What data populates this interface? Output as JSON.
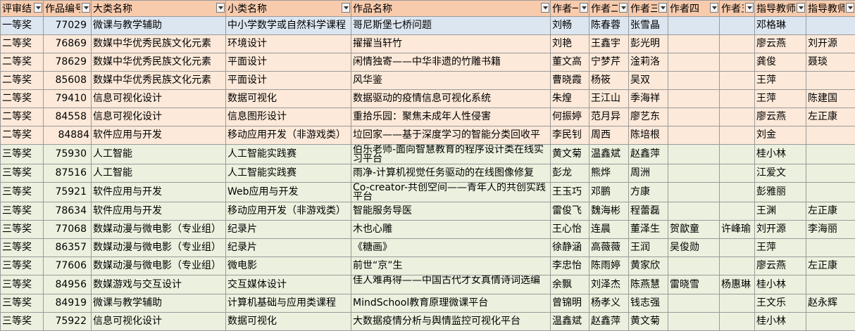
{
  "columns": [
    {
      "label": "评审结果",
      "width": 61
    },
    {
      "label": "作品编号",
      "width": 68
    },
    {
      "label": "大类名称",
      "width": 191
    },
    {
      "label": "小类名称",
      "width": 178
    },
    {
      "label": "作品名称",
      "width": 283
    },
    {
      "label": "作者一",
      "width": 55
    },
    {
      "label": "作者二",
      "width": 56
    },
    {
      "label": "作者三",
      "width": 56
    },
    {
      "label": "作者四",
      "width": 73
    },
    {
      "label": "作者五",
      "width": 50
    },
    {
      "label": "指导教师一",
      "width": 73
    },
    {
      "label": "指导教师二",
      "width": 70
    }
  ],
  "rows": [
    {
      "style": "r-blue",
      "cells": [
        "一等奖",
        "77029",
        "微课与教学辅助",
        "中小学数学或自然科学课程",
        "哥尼斯堡七桥问题",
        "刘畅",
        "陈春蓉",
        "张雪晶",
        "",
        "",
        "邓格琳",
        ""
      ]
    },
    {
      "style": "r-peach",
      "cells": [
        "二等奖",
        "76869",
        "数媒中华优秀民族文化元素",
        "环境设计",
        "擢擢当轩竹",
        "刘艳",
        "王鑫宇",
        "彭光明",
        "",
        "",
        "廖云燕",
        "刘开源"
      ]
    },
    {
      "style": "r-peach",
      "cells": [
        "二等奖",
        "78629",
        "数媒中华优秀民族文化元素",
        "平面设计",
        "闲情独寄——中华非遗的竹雕书籍",
        "董文高",
        "宁梦芹",
        "淦莉洛",
        "",
        "",
        "龚俊",
        "聂琰"
      ]
    },
    {
      "style": "r-peach",
      "cells": [
        "二等奖",
        "85608",
        "数媒中华优秀民族文化元素",
        "平面设计",
        "风华鉴",
        "曹晓霞",
        "杨筱",
        "吴双",
        "",
        "",
        "王萍",
        ""
      ]
    },
    {
      "style": "r-peach",
      "cells": [
        "二等奖",
        "79410",
        "信息可视化设计",
        "数据可视化",
        "数据驱动的疫情信息可视化系统",
        "朱煌",
        "王江山",
        "季海祥",
        "",
        "",
        "王萍",
        "陈建国"
      ]
    },
    {
      "style": "r-peach",
      "cells": [
        "二等奖",
        "84558",
        "信息可视化设计",
        "信息图形设计",
        "重拾乐园：聚焦未成年人性侵害",
        "何振婷",
        "范月异",
        "廖艺东",
        "",
        "",
        "廖云燕",
        "左正康"
      ]
    },
    {
      "style": "r-peach",
      "cells": [
        "二等奖",
        "84884",
        "软件应用与开发",
        "移动应用开发（非游戏类）",
        "垃回家——基于深度学习的智能分类回收平",
        "李民钊",
        "周西",
        "陈培根",
        "",
        "",
        "刘金",
        ""
      ]
    },
    {
      "style": "r-green",
      "cells": [
        "三等奖",
        "75930",
        "人工智能",
        "人工智能实践赛",
        "伯乐老师-面向智慧教育的程序设计类在线实习平台",
        "黄文菊",
        "温鑫斌",
        "赵鑫萍",
        "",
        "",
        "桂小林",
        ""
      ]
    },
    {
      "style": "r-green",
      "cells": [
        "三等奖",
        "87516",
        "人工智能",
        "人工智能实践赛",
        "雨净-计算机视觉任务驱动的在线图像修复",
        "彭龙",
        "熊烨",
        "周洲",
        "",
        "",
        "江爱文",
        ""
      ]
    },
    {
      "style": "r-green",
      "cells": [
        "三等奖",
        "75921",
        "软件应用与开发",
        "Web应用与开发",
        "Co-creator-共创空间——青年人的共创实践平台",
        "王玉巧",
        "邓鹏",
        "方康",
        "",
        "",
        "彭雅丽",
        ""
      ]
    },
    {
      "style": "r-green",
      "cells": [
        "三等奖",
        "78634",
        "软件应用与开发",
        "移动应用开发（非游戏类）",
        "智能服务导医",
        "雷俊飞",
        "魏海彬",
        "程蕾磊",
        "",
        "",
        "王渊",
        "左正康"
      ]
    },
    {
      "style": "r-green",
      "cells": [
        "三等奖",
        "77068",
        "数媒动漫与微电影（专业组）",
        "纪录片",
        "木也心雕",
        "王心怡",
        "连晨",
        "董泽生",
        "贺歆童",
        "许峰瑜",
        "刘开源",
        "李海丽"
      ]
    },
    {
      "style": "r-green",
      "cells": [
        "三等奖",
        "86357",
        "数媒动漫与微电影（专业组）",
        "纪录片",
        "《糖画》",
        "徐静涵",
        "高薇薇",
        "王润",
        "吴俊勋",
        "",
        "王萍",
        ""
      ]
    },
    {
      "style": "r-green",
      "cells": [
        "三等奖",
        "77606",
        "数媒动漫与微电影（专业组）",
        "微电影",
        "前世“京”生",
        "李忠怡",
        "陈雨婷",
        "黄家欣",
        "",
        "",
        "廖云燕",
        "左正康"
      ]
    },
    {
      "style": "r-green",
      "cells": [
        "三等奖",
        "84956",
        "数媒游戏与交互设计",
        "交互媒体设计",
        "佳人难再得——中国古代才女真情诗词选编",
        "余飘",
        "刘泽杰",
        "陈燕慧",
        "雷晓雪",
        "杨惠琳",
        "桂小林",
        ""
      ]
    },
    {
      "style": "r-green",
      "cells": [
        "三等奖",
        "84919",
        "微课与教学辅助",
        "计算机基础与应用类课程",
        "MindSchool教育原理微课平台",
        "曾锦明",
        "杨孝义",
        "钱志强",
        "",
        "",
        "王文乐",
        "赵永辉"
      ]
    },
    {
      "style": "r-green",
      "cells": [
        "三等奖",
        "75922",
        "信息可视化设计",
        "数据可视化",
        "大数据疫情分析与舆情监控可视化平台",
        "温鑫斌",
        "赵鑫萍",
        "黄文菊",
        "",
        "",
        "桂小林",
        ""
      ]
    }
  ]
}
